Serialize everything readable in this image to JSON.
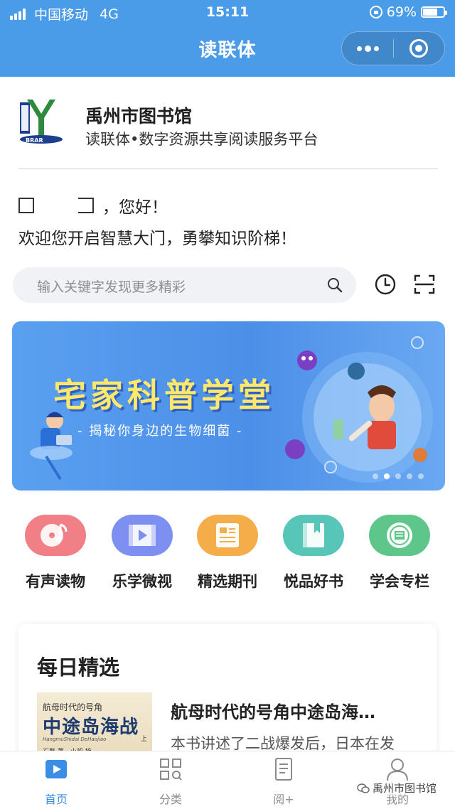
{
  "status_bar": {
    "carrier": "中国移动",
    "network": "4G",
    "time": "15:11",
    "battery": "69%"
  },
  "nav": {
    "title": "读联体"
  },
  "library": {
    "name": "禹州市图书馆",
    "subtitle": "读联体•数字资源共享阅读服务平台"
  },
  "greeting": {
    "hello": "，您好！",
    "welcome": "欢迎您开启智慧大门，勇攀知识阶梯！"
  },
  "search": {
    "placeholder": "输入关键字发现更多精彩"
  },
  "banner": {
    "title": "宅家科普学堂",
    "subtitle": "- 揭秘你身边的生物细菌 -",
    "dot_count": 5,
    "active_dot": 1
  },
  "categories": [
    {
      "label": "有声读物",
      "icon": "audio-disc-icon",
      "color": "#f07f86"
    },
    {
      "label": "乐学微视",
      "icon": "video-icon",
      "color": "#7d8ff0"
    },
    {
      "label": "精选期刊",
      "icon": "journal-icon",
      "color": "#f5ad4a"
    },
    {
      "label": "悦品好书",
      "icon": "book-icon",
      "color": "#57c6b8"
    },
    {
      "label": "学会专栏",
      "icon": "emblem-icon",
      "color": "#5ec68a"
    }
  ],
  "daily": {
    "title": "每日精选",
    "book_title": "航母时代的号角中途岛海…",
    "book_desc": "本书讲述了二战爆发后，日本在发",
    "cover": {
      "line1": "航母时代的号角",
      "line2": "中途岛海战",
      "line3": "HangmuShidai DeHaojiao",
      "line4": "石磊 著　小船 摘",
      "line5": "上"
    }
  },
  "tabs": [
    {
      "label": "首页",
      "icon": "home-icon",
      "active": true
    },
    {
      "label": "分类",
      "icon": "category-grid-icon",
      "active": false
    },
    {
      "label": "阅+",
      "icon": "reading-icon",
      "active": false
    },
    {
      "label": "我的",
      "icon": "profile-icon",
      "active": false
    }
  ],
  "watermark": "禹州市图书馆",
  "colors": {
    "brand": "#4a9be8",
    "active_tab": "#3a8ee6"
  }
}
